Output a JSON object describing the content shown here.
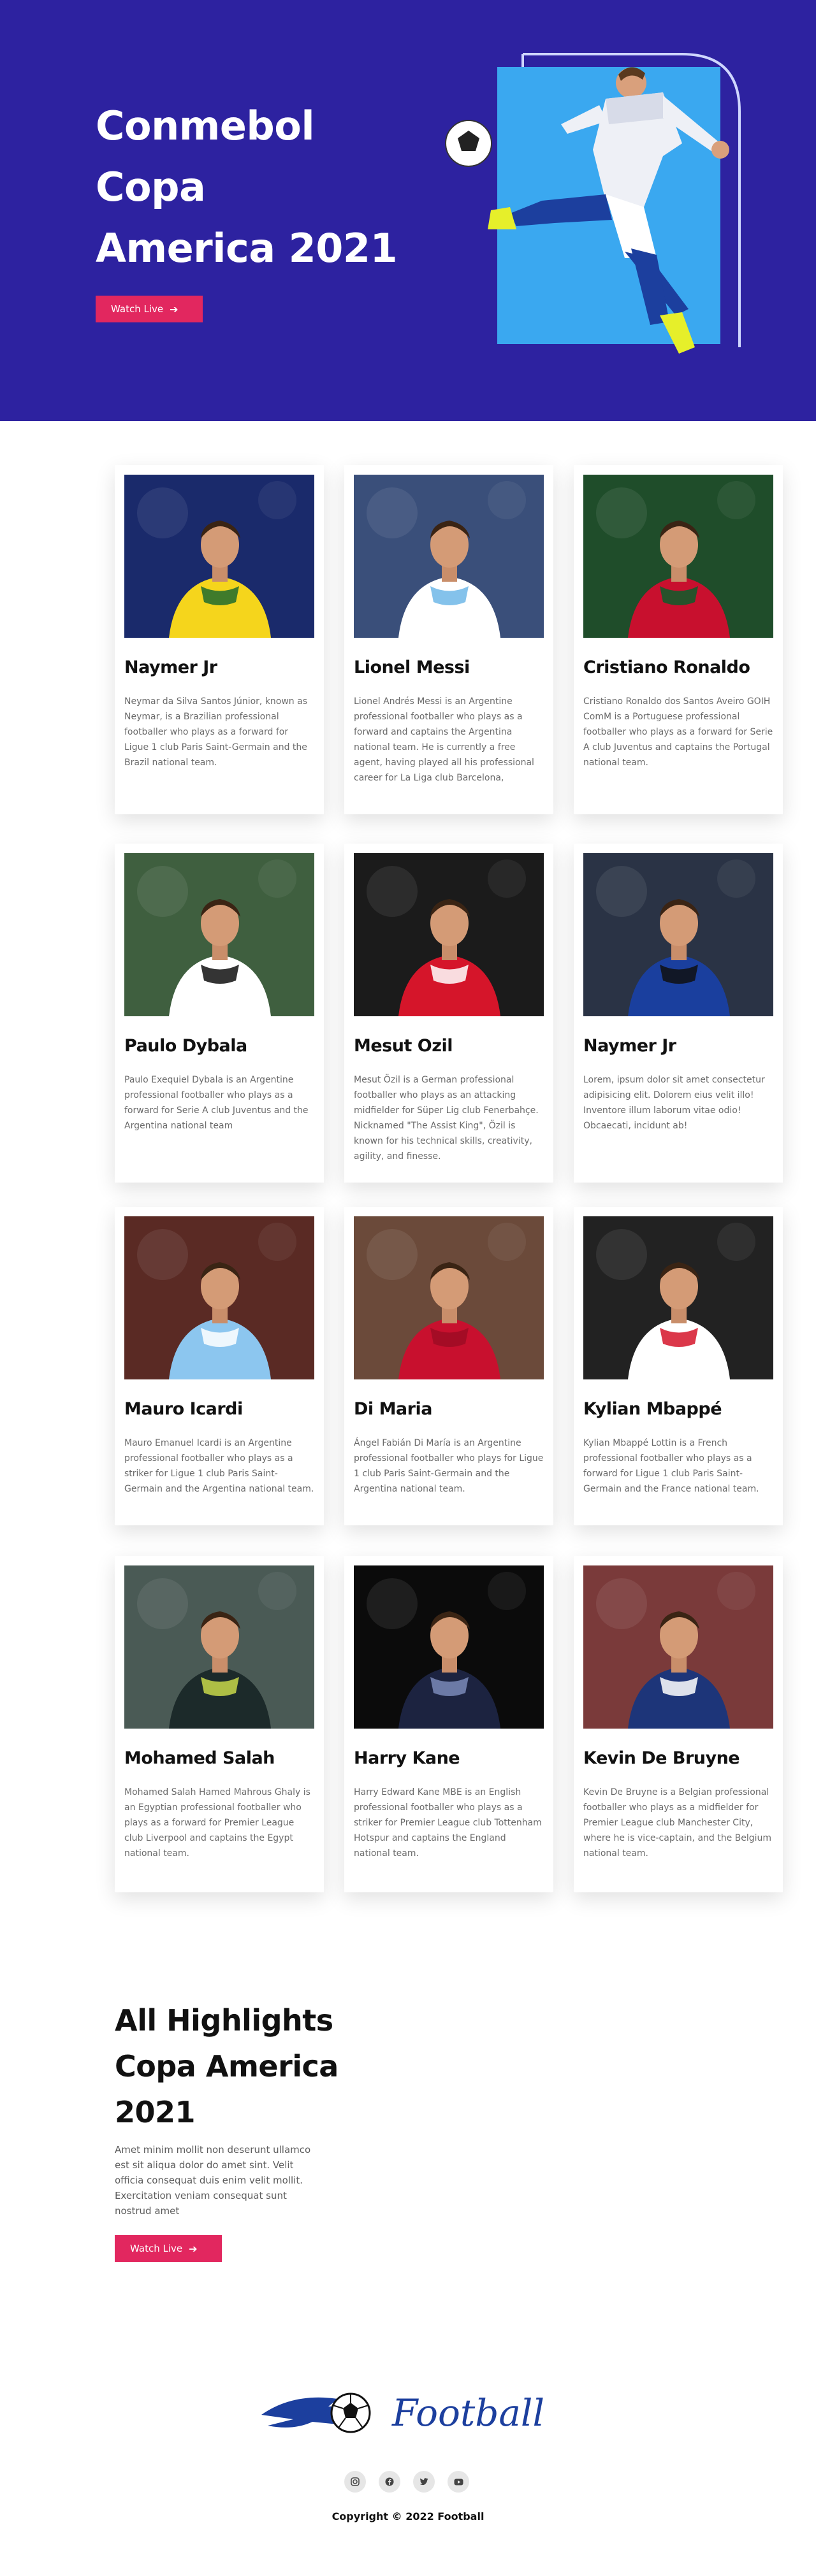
{
  "hero": {
    "title_line1": "Conmebol",
    "title_line2": "Copa",
    "title_line3": "America 2021",
    "button_label": "Watch Live",
    "accent": "#e2275f",
    "background": "#2d22a0",
    "frame_color": "#3aa8f0"
  },
  "players": [
    {
      "name": "Naymer Jr",
      "description": "Neymar da Silva Santos Júnior, known as Neymar, is a Brazilian professional footballer who plays as a forward for Ligue 1 club Paris Saint-Germain and the Brazil national team.",
      "kit": "#f5d51c",
      "kit2": "#1e6b2e",
      "bg": "#1a2a6b"
    },
    {
      "name": "Lionel Messi",
      "description": "Lionel Andrés Messi is an Argentine professional footballer who plays as a forward and captains the Argentina national team. He is currently a free agent, having played all his professional career for La Liga club Barcelona,",
      "kit": "#ffffff",
      "kit2": "#6fb7e8",
      "bg": "#3a4f7a"
    },
    {
      "name": "Cristiano Ronaldo",
      "description": "Cristiano Ronaldo dos Santos Aveiro GOIH ComM is a Portuguese professional footballer who plays as a forward for Serie A club Juventus and captains the Portugal national team.",
      "kit": "#c8102e",
      "kit2": "#0a5e2a",
      "bg": "#1f4d2a"
    },
    {
      "name": "Paulo Dybala",
      "description": "Paulo Exequiel Dybala is an Argentine professional footballer who plays as a forward for Serie A club Juventus and the Argentina national team",
      "kit": "#ffffff",
      "kit2": "#111111",
      "bg": "#3f5f3f"
    },
    {
      "name": "Mesut Ozil",
      "description": "Mesut Özil is a German professional footballer who plays as an attacking midfielder for Süper Lig club Fenerbahçe. Nicknamed \"The Assist King\", Özil is known for his technical skills, creativity, agility, and finesse.",
      "kit": "#d5152a",
      "kit2": "#ffffff",
      "bg": "#1b1b1b"
    },
    {
      "name": "Naymer Jr",
      "description": "Lorem, ipsum dolor sit amet consectetur adipisicing elit. Dolorem eius velit illo! Inventore illum laborum vitae odio! Obcaecati, incidunt ab!",
      "kit": "#1a3f9e",
      "kit2": "#111111",
      "bg": "#2a3345"
    },
    {
      "name": "Mauro Icardi",
      "description": "Mauro Emanuel Icardi is an Argentine professional footballer who plays as a striker for Ligue 1 club Paris Saint-Germain and the Argentina national team.",
      "kit": "#8cc6ef",
      "kit2": "#ffffff",
      "bg": "#5a2a24"
    },
    {
      "name": "Di Maria",
      "description": "Ángel Fabián Di María is an Argentine professional footballer who plays for Ligue 1 club Paris Saint-Germain and the Argentina national team.",
      "kit": "#c8102e",
      "kit2": "#9e0c23",
      "bg": "#6b4a3a"
    },
    {
      "name": "Kylian Mbappé",
      "description": "Kylian Mbappé Lottin is a French professional footballer who plays as a forward for Ligue 1 club Paris Saint-Germain and the France national team.",
      "kit": "#ffffff",
      "kit2": "#d5152a",
      "bg": "#222222"
    },
    {
      "name": "Mohamed Salah",
      "description": "Mohamed Salah Hamed Mahrous Ghaly is an Egyptian professional footballer who plays as a forward for Premier League club Liverpool and captains the Egypt national team.",
      "kit": "#1c2a2a",
      "kit2": "#c8d84a",
      "bg": "#4a5a55"
    },
    {
      "name": "Harry Kane",
      "description": "Harry Edward Kane MBE is an English professional footballer who plays as a striker for Premier League club Tottenham Hotspur and captains the England national team.",
      "kit": "#1c2340",
      "kit2": "#7a8ab8",
      "bg": "#0b0b0b"
    },
    {
      "name": "Kevin De Bruyne",
      "description": "Kevin De Bruyne is a Belgian professional footballer who plays as a midfielder for Premier League club Manchester City, where he is vice-captain, and the Belgium national team.",
      "kit": "#1d3579",
      "kit2": "#ffffff",
      "bg": "#7a3a3a"
    }
  ],
  "highlights": {
    "title_line1": "All Highlights",
    "title_line2": "Copa America",
    "title_line3": "2021",
    "text": "Amet minim mollit non deserunt ullamco est sit aliqua dolor do amet sint. Velit officia consequat duis enim velit mollit. Exercitation veniam consequat sunt nostrud amet",
    "button_label": "Watch Live"
  },
  "footer": {
    "logo_text": "Football",
    "logo_color": "#1c3f9e",
    "social_icons": [
      "instagram-icon",
      "facebook-icon",
      "twitter-icon",
      "youtube-icon"
    ],
    "copyright": "Copyright © 2022 Football"
  }
}
